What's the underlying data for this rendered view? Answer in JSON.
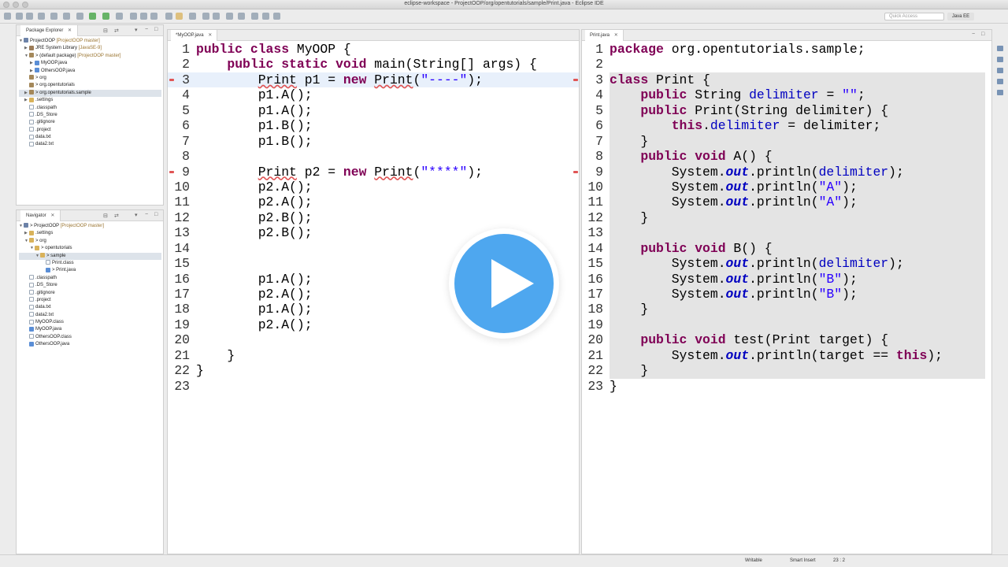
{
  "window": {
    "title": "eclipse-workspace - ProjectOOP/org/opentutorials/sample/Print.java - Eclipse IDE"
  },
  "toolbar": {
    "quick_access_placeholder": "Quick Access",
    "perspective": "Java EE"
  },
  "package_explorer": {
    "tab_label": "Package Explorer",
    "items": [
      {
        "label": "ProjectOOP",
        "deco": " [ProjectOOP master]",
        "icon": "project-icon",
        "indent": 0,
        "chev": "▼"
      },
      {
        "label": "JRE System Library",
        "deco": " [JavaSE-9]",
        "icon": "library-icon",
        "indent": 1,
        "chev": "▶"
      },
      {
        "label": "> (default package)",
        "deco": " [ProjectOOP master]",
        "icon": "package-icon",
        "indent": 1,
        "chev": "▼"
      },
      {
        "label": "MyOOP.java",
        "deco": "",
        "icon": "java-file-icon",
        "indent": 2,
        "chev": "▶"
      },
      {
        "label": "OthersOOP.java",
        "deco": "",
        "icon": "java-file-icon",
        "indent": 2,
        "chev": "▶"
      },
      {
        "label": "> org",
        "deco": "",
        "icon": "package-icon",
        "indent": 1,
        "chev": ""
      },
      {
        "label": "> org.opentutorials",
        "deco": "",
        "icon": "package-icon",
        "indent": 1,
        "chev": ""
      },
      {
        "label": "> org.opentutorials.sample",
        "deco": "",
        "icon": "package-icon",
        "indent": 1,
        "chev": "▶",
        "selected": true
      },
      {
        "label": ".settings",
        "deco": "",
        "icon": "folder-icon",
        "indent": 1,
        "chev": "▶"
      },
      {
        "label": ".classpath",
        "deco": "",
        "icon": "file-icon",
        "indent": 1,
        "chev": ""
      },
      {
        "label": ".DS_Store",
        "deco": "",
        "icon": "file-icon",
        "indent": 1,
        "chev": ""
      },
      {
        "label": ".gitignore",
        "deco": "",
        "icon": "file-icon",
        "indent": 1,
        "chev": ""
      },
      {
        "label": ".project",
        "deco": "",
        "icon": "file-icon",
        "indent": 1,
        "chev": ""
      },
      {
        "label": "data.txt",
        "deco": "",
        "icon": "file-icon",
        "indent": 1,
        "chev": ""
      },
      {
        "label": "data2.txt",
        "deco": "",
        "icon": "file-icon",
        "indent": 1,
        "chev": ""
      }
    ]
  },
  "navigator": {
    "tab_label": "Navigator",
    "items": [
      {
        "label": "> ProjectOOP",
        "deco": " [ProjectOOP master]",
        "icon": "project-icon",
        "indent": 0,
        "chev": "▼"
      },
      {
        "label": ".settings",
        "deco": "",
        "icon": "folder-icon",
        "indent": 1,
        "chev": "▶"
      },
      {
        "label": "> org",
        "deco": "",
        "icon": "folder-icon",
        "indent": 1,
        "chev": "▼"
      },
      {
        "label": "> opentutorials",
        "deco": "",
        "icon": "folder-icon",
        "indent": 2,
        "chev": "▼"
      },
      {
        "label": "> sample",
        "deco": "",
        "icon": "folder-icon",
        "indent": 3,
        "chev": "▼",
        "selected": true
      },
      {
        "label": "Print.class",
        "deco": "",
        "icon": "file-icon",
        "indent": 4,
        "chev": ""
      },
      {
        "label": "> Print.java",
        "deco": "",
        "icon": "java-file-icon",
        "indent": 4,
        "chev": ""
      },
      {
        "label": ".classpath",
        "deco": "",
        "icon": "file-icon",
        "indent": 1,
        "chev": ""
      },
      {
        "label": ".DS_Store",
        "deco": "",
        "icon": "file-icon",
        "indent": 1,
        "chev": ""
      },
      {
        "label": ".gitignore",
        "deco": "",
        "icon": "file-icon",
        "indent": 1,
        "chev": ""
      },
      {
        "label": ".project",
        "deco": "",
        "icon": "file-icon",
        "indent": 1,
        "chev": ""
      },
      {
        "label": "data.txt",
        "deco": "",
        "icon": "file-icon",
        "indent": 1,
        "chev": ""
      },
      {
        "label": "data2.txt",
        "deco": "",
        "icon": "file-icon",
        "indent": 1,
        "chev": ""
      },
      {
        "label": "MyOOP.class",
        "deco": "",
        "icon": "file-icon",
        "indent": 1,
        "chev": ""
      },
      {
        "label": "MyOOP.java",
        "deco": "",
        "icon": "java-file-icon",
        "indent": 1,
        "chev": ""
      },
      {
        "label": "OthersOOP.class",
        "deco": "",
        "icon": "file-icon",
        "indent": 1,
        "chev": ""
      },
      {
        "label": "OthersOOP.java",
        "deco": "",
        "icon": "java-file-icon",
        "indent": 1,
        "chev": ""
      }
    ]
  },
  "left_editor": {
    "tab_label": "*MyOOP.java",
    "lines": [
      {
        "n": "1",
        "code": [
          [
            "k",
            "public class"
          ],
          [
            "t",
            " MyOOP {"
          ]
        ]
      },
      {
        "n": "2",
        "code": [
          [
            "t",
            "    "
          ],
          [
            "k",
            "public static void"
          ],
          [
            "t",
            " main(String[] args) {"
          ]
        ]
      },
      {
        "n": "3",
        "code": [
          [
            "t",
            "        "
          ],
          [
            "e",
            "Print"
          ],
          [
            "t",
            " p1 = "
          ],
          [
            "k",
            "new"
          ],
          [
            "t",
            " "
          ],
          [
            "e",
            "Print"
          ],
          [
            "t",
            "("
          ],
          [
            "s",
            "\"----\""
          ],
          [
            "t",
            ");"
          ]
        ],
        "highlight": true
      },
      {
        "n": "4",
        "code": [
          [
            "t",
            "        p1.A();"
          ]
        ]
      },
      {
        "n": "5",
        "code": [
          [
            "t",
            "        p1.A();"
          ]
        ]
      },
      {
        "n": "6",
        "code": [
          [
            "t",
            "        p1.B();"
          ]
        ]
      },
      {
        "n": "7",
        "code": [
          [
            "t",
            "        p1.B();"
          ]
        ]
      },
      {
        "n": "8",
        "code": []
      },
      {
        "n": "9",
        "code": [
          [
            "t",
            "        "
          ],
          [
            "e",
            "Print"
          ],
          [
            "t",
            " p2 = "
          ],
          [
            "k",
            "new"
          ],
          [
            "t",
            " "
          ],
          [
            "e",
            "Print"
          ],
          [
            "t",
            "("
          ],
          [
            "s",
            "\"****\""
          ],
          [
            "t",
            ");"
          ]
        ]
      },
      {
        "n": "10",
        "code": [
          [
            "t",
            "        p2.A();"
          ]
        ]
      },
      {
        "n": "11",
        "code": [
          [
            "t",
            "        p2.A();"
          ]
        ]
      },
      {
        "n": "12",
        "code": [
          [
            "t",
            "        p2.B();"
          ]
        ]
      },
      {
        "n": "13",
        "code": [
          [
            "t",
            "        p2.B();"
          ]
        ]
      },
      {
        "n": "14",
        "code": []
      },
      {
        "n": "15",
        "code": []
      },
      {
        "n": "16",
        "code": [
          [
            "t",
            "        p1.A();"
          ]
        ]
      },
      {
        "n": "17",
        "code": [
          [
            "t",
            "        p2.A();"
          ]
        ]
      },
      {
        "n": "18",
        "code": [
          [
            "t",
            "        p1.A();"
          ]
        ]
      },
      {
        "n": "19",
        "code": [
          [
            "t",
            "        p2.A();"
          ]
        ]
      },
      {
        "n": "20",
        "code": []
      },
      {
        "n": "21",
        "code": [
          [
            "t",
            "    }"
          ]
        ]
      },
      {
        "n": "22",
        "code": [
          [
            "t",
            "}"
          ]
        ]
      },
      {
        "n": "23",
        "code": []
      }
    ]
  },
  "right_editor": {
    "tab_label": "Print.java",
    "lines": [
      {
        "n": "1",
        "code": [
          [
            "k",
            "package"
          ],
          [
            "t",
            " org.opentutorials.sample;"
          ]
        ]
      },
      {
        "n": "2",
        "code": []
      },
      {
        "n": "3",
        "code": [
          [
            "k",
            "class"
          ],
          [
            "t",
            " Print {"
          ]
        ],
        "shade": true
      },
      {
        "n": "4",
        "code": [
          [
            "t",
            "    "
          ],
          [
            "k",
            "public"
          ],
          [
            "t",
            " String "
          ],
          [
            "f",
            "delimiter"
          ],
          [
            "t",
            " = "
          ],
          [
            "s",
            "\"\""
          ],
          [
            "t",
            ";"
          ]
        ],
        "shade": true
      },
      {
        "n": "5",
        "code": [
          [
            "t",
            "    "
          ],
          [
            "k",
            "public"
          ],
          [
            "t",
            " Print(String delimiter) {"
          ]
        ],
        "shade": true
      },
      {
        "n": "6",
        "code": [
          [
            "t",
            "        "
          ],
          [
            "k",
            "this"
          ],
          [
            "t",
            "."
          ],
          [
            "f",
            "delimiter"
          ],
          [
            "t",
            " = delimiter;"
          ]
        ],
        "shade": true
      },
      {
        "n": "7",
        "code": [
          [
            "t",
            "    }"
          ]
        ],
        "shade": true
      },
      {
        "n": "8",
        "code": [
          [
            "t",
            "    "
          ],
          [
            "k",
            "public void"
          ],
          [
            "t",
            " A() {"
          ]
        ],
        "shade": true
      },
      {
        "n": "9",
        "code": [
          [
            "t",
            "        System."
          ],
          [
            "o",
            "out"
          ],
          [
            "t",
            ".println("
          ],
          [
            "f",
            "delimiter"
          ],
          [
            "t",
            ");"
          ]
        ],
        "shade": true
      },
      {
        "n": "10",
        "code": [
          [
            "t",
            "        System."
          ],
          [
            "o",
            "out"
          ],
          [
            "t",
            ".println("
          ],
          [
            "s",
            "\"A\""
          ],
          [
            "t",
            ");"
          ]
        ],
        "shade": true
      },
      {
        "n": "11",
        "code": [
          [
            "t",
            "        System."
          ],
          [
            "o",
            "out"
          ],
          [
            "t",
            ".println("
          ],
          [
            "s",
            "\"A\""
          ],
          [
            "t",
            ");"
          ]
        ],
        "shade": true
      },
      {
        "n": "12",
        "code": [
          [
            "t",
            "    }"
          ]
        ],
        "shade": true
      },
      {
        "n": "13",
        "code": [],
        "shade": true
      },
      {
        "n": "14",
        "code": [
          [
            "t",
            "    "
          ],
          [
            "k",
            "public void"
          ],
          [
            "t",
            " B() {"
          ]
        ],
        "shade": true
      },
      {
        "n": "15",
        "code": [
          [
            "t",
            "        System."
          ],
          [
            "o",
            "out"
          ],
          [
            "t",
            ".println("
          ],
          [
            "f",
            "delimiter"
          ],
          [
            "t",
            ");"
          ]
        ],
        "shade": true
      },
      {
        "n": "16",
        "code": [
          [
            "t",
            "        System."
          ],
          [
            "o",
            "out"
          ],
          [
            "t",
            ".println("
          ],
          [
            "s",
            "\"B\""
          ],
          [
            "t",
            ");"
          ]
        ],
        "shade": true
      },
      {
        "n": "17",
        "code": [
          [
            "t",
            "        System."
          ],
          [
            "o",
            "out"
          ],
          [
            "t",
            ".println("
          ],
          [
            "s",
            "\"B\""
          ],
          [
            "t",
            ");"
          ]
        ],
        "shade": true
      },
      {
        "n": "18",
        "code": [
          [
            "t",
            "    }"
          ]
        ],
        "shade": true
      },
      {
        "n": "19",
        "code": [],
        "shade": true
      },
      {
        "n": "20",
        "code": [
          [
            "t",
            "    "
          ],
          [
            "k",
            "public void"
          ],
          [
            "t",
            " test(Print target) {"
          ]
        ],
        "shade": true
      },
      {
        "n": "21",
        "code": [
          [
            "t",
            "        System."
          ],
          [
            "o",
            "out"
          ],
          [
            "t",
            ".println(target == "
          ],
          [
            "k",
            "this"
          ],
          [
            "t",
            ");"
          ]
        ],
        "shade": true
      },
      {
        "n": "22",
        "code": [
          [
            "t",
            "    }"
          ]
        ],
        "shade": true
      },
      {
        "n": "23",
        "code": [
          [
            "t",
            "}"
          ]
        ]
      }
    ]
  },
  "status_bar": {
    "writable": "Writable",
    "insert_mode": "Smart Insert",
    "position": "23 : 2"
  },
  "overlay": {
    "icon": "play-icon"
  }
}
